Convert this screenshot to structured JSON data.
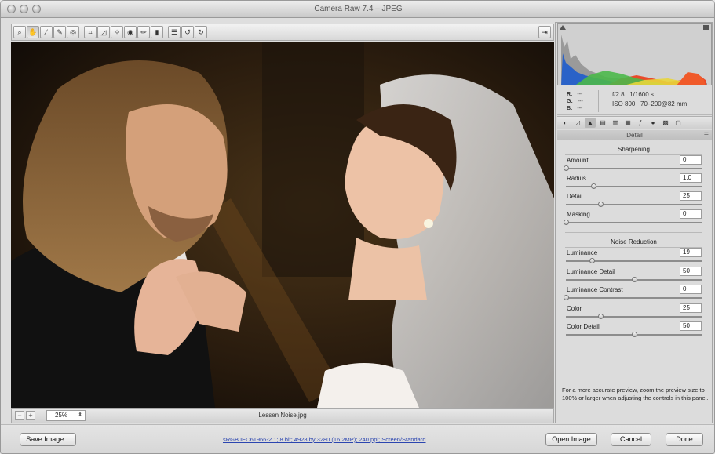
{
  "window": {
    "title": "Camera Raw 7.4  –  JPEG"
  },
  "toolbar": {
    "tools": [
      "zoom-icon",
      "hand-icon",
      "white-balance-icon",
      "color-sampler-icon",
      "targeted-adjustment-icon",
      "crop-icon",
      "straighten-icon",
      "spot-removal-icon",
      "red-eye-icon",
      "adjustment-brush-icon",
      "graduated-filter-icon",
      "preferences-icon",
      "rotate-ccw-icon",
      "rotate-cw-icon"
    ],
    "active_tool": "hand-icon",
    "fullscreen_icon": "fullscreen-toggle-icon"
  },
  "preview": {
    "zoom_value": "25%",
    "filename": "Lessen Noise.jpg"
  },
  "readout": {
    "r": "R:",
    "g": "G:",
    "b": "B:",
    "r_val": "---",
    "g_val": "---",
    "b_val": "---",
    "exif_line1": "f/2.8   1/1600 s",
    "exif_line2": "ISO 800   70–200@82 mm"
  },
  "panel": {
    "title": "Detail",
    "tabs": [
      "basic-icon",
      "tone-curve-icon",
      "detail-icon",
      "hsl-icon",
      "split-toning-icon",
      "lens-corrections-icon",
      "effects-icon",
      "camera-calibration-icon",
      "presets-icon",
      "snapshots-icon"
    ],
    "active_tab": 2,
    "sharpening": {
      "heading": "Sharpening",
      "controls": [
        {
          "label": "Amount",
          "value": "0",
          "fraction": 0.0
        },
        {
          "label": "Radius",
          "value": "1.0",
          "fraction": 0.2
        },
        {
          "label": "Detail",
          "value": "25",
          "fraction": 0.25
        },
        {
          "label": "Masking",
          "value": "0",
          "fraction": 0.0
        }
      ]
    },
    "noise": {
      "heading": "Noise Reduction",
      "controls": [
        {
          "label": "Luminance",
          "value": "19",
          "fraction": 0.19
        },
        {
          "label": "Luminance Detail",
          "value": "50",
          "fraction": 0.5
        },
        {
          "label": "Luminance Contrast",
          "value": "0",
          "fraction": 0.0
        },
        {
          "label": "Color",
          "value": "25",
          "fraction": 0.25
        },
        {
          "label": "Color Detail",
          "value": "50",
          "fraction": 0.5
        }
      ]
    },
    "note": "For a more accurate preview, zoom the preview size to 100% or larger when adjusting the controls in this panel."
  },
  "footer": {
    "save_label": "Save Image...",
    "workflow_link": "sRGB IEC61966-2.1; 8 bit; 4928 by 3280 (16.2MP); 240 ppi; Screen/Standard",
    "open_label": "Open Image",
    "cancel_label": "Cancel",
    "done_label": "Done"
  }
}
